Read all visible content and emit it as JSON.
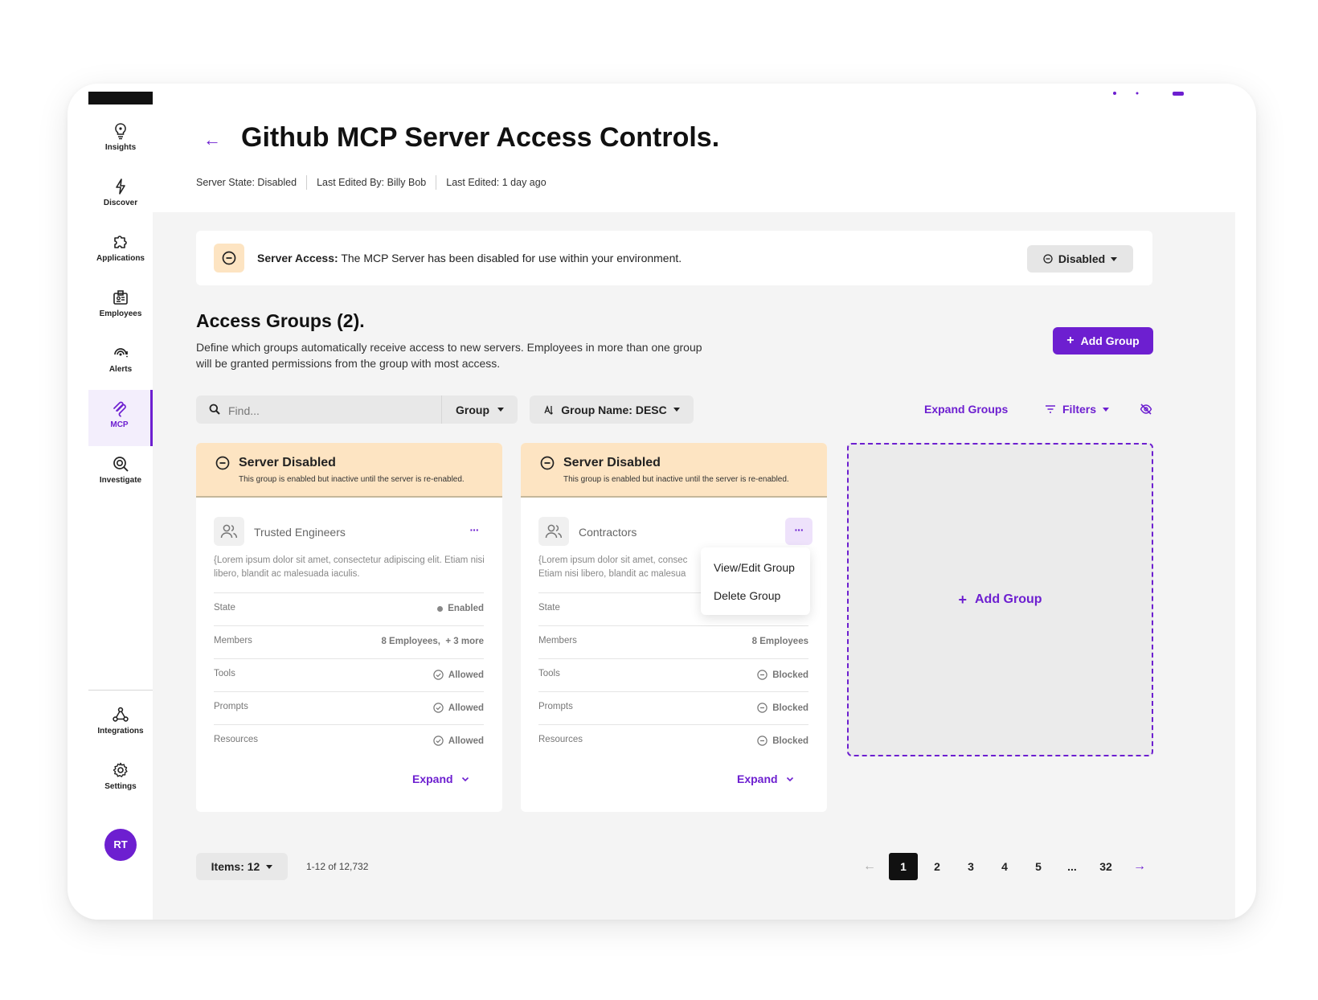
{
  "sidebar": {
    "items": [
      {
        "label": "Insights",
        "icon": "lightbulb-icon"
      },
      {
        "label": "Discover",
        "icon": "lightning-icon"
      },
      {
        "label": "Applications",
        "icon": "puzzle-icon"
      },
      {
        "label": "Employees",
        "icon": "badge-icon"
      },
      {
        "label": "Alerts",
        "icon": "signal-alert-icon"
      },
      {
        "label": "MCP",
        "icon": "mcp-icon",
        "active": true
      },
      {
        "label": "Investigate",
        "icon": "magnifier-icon"
      }
    ],
    "bottom_items": [
      {
        "label": "Integrations",
        "icon": "network-icon"
      },
      {
        "label": "Settings",
        "icon": "gear-icon"
      }
    ],
    "avatar": "RT"
  },
  "header": {
    "title": "Github MCP Server Access Controls.",
    "meta": [
      "Server State: Disabled",
      "Last Edited By: Billy Bob",
      "Last Edited: 1 day ago"
    ]
  },
  "alert": {
    "label": "Server Access:",
    "message": "The MCP Server has been disabled for use within your environment.",
    "status": "Disabled"
  },
  "groups_section": {
    "title": "Access Groups (2).",
    "description": "Define which groups automatically receive access to new servers. Employees in more than one group will be granted permissions from the group with most access.",
    "add_button": "Add Group"
  },
  "toolbar": {
    "search_placeholder": "Find...",
    "group_select": "Group",
    "sort_select": "Group Name: DESC",
    "expand_groups": "Expand Groups",
    "filters": "Filters"
  },
  "cards": [
    {
      "warning_title": "Server Disabled",
      "warning_sub": "This group is enabled but inactive until the server is re-enabled.",
      "name": "Trusted Engineers",
      "more": "···",
      "desc": "{Lorem ipsum dolor sit amet, consectetur adipiscing elit. Etiam nisi libero, blandit ac malesuada iaculis.",
      "rows": [
        {
          "key": "State",
          "value": "Enabled"
        },
        {
          "key": "Members",
          "value": "8 Employees,  + 3 more"
        },
        {
          "key": "Tools",
          "value": "Allowed"
        },
        {
          "key": "Prompts",
          "value": "Allowed"
        },
        {
          "key": "Resources",
          "value": "Allowed"
        }
      ],
      "expand": "Expand"
    },
    {
      "warning_title": "Server Disabled",
      "warning_sub": "This group is enabled but inactive until the server is re-enabled.",
      "name": "Contractors",
      "more": "···",
      "desc": "{Lorem ipsum dolor sit amet, consec Etiam nisi libero, blandit ac malesua",
      "rows": [
        {
          "key": "State",
          "value": ""
        },
        {
          "key": "Members",
          "value": "8 Employees"
        },
        {
          "key": "Tools",
          "value": "Blocked"
        },
        {
          "key": "Prompts",
          "value": "Blocked"
        },
        {
          "key": "Resources",
          "value": "Blocked"
        }
      ],
      "expand": "Expand",
      "menu": [
        "View/Edit Group",
        "Delete Group"
      ]
    }
  ],
  "add_card_label": "Add Group",
  "pagination": {
    "items": "Items: 12",
    "range": "1-12 of 12,732",
    "pages": [
      "1",
      "2",
      "3",
      "4",
      "5",
      "...",
      "32"
    ],
    "current": "1"
  },
  "colors": {
    "accent": "#6d1fd0",
    "warning_bg": "#fde4c2",
    "content_bg": "#f4f4f4"
  }
}
